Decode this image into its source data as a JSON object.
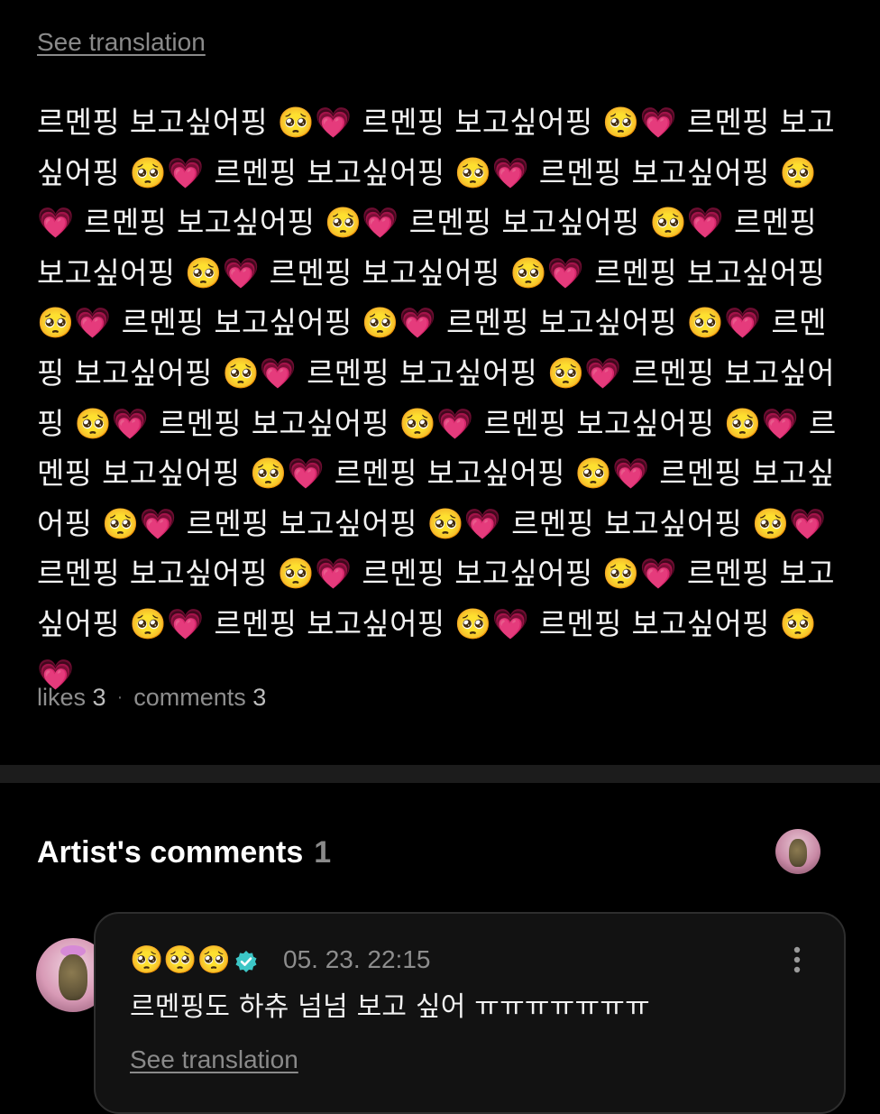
{
  "post": {
    "see_translation_label": "See translation",
    "body": "르멘핑 보고싶어핑 🥺💗 르멘핑 보고싶어핑 🥺💗 르멘핑 보고싶어핑 🥺💗 르멘핑 보고싶어핑 🥺💗 르멘핑 보고싶어핑 🥺💗 르멘핑 보고싶어핑 🥺💗 르멘핑 보고싶어핑 🥺💗 르멘핑 보고싶어핑 🥺💗 르멘핑 보고싶어핑 🥺💗 르멘핑 보고싶어핑 🥺💗 르멘핑 보고싶어핑 🥺💗 르멘핑 보고싶어핑 🥺💗 르멘핑 보고싶어핑 🥺💗 르멘핑 보고싶어핑 🥺💗 르멘핑 보고싶어핑 🥺💗 르멘핑 보고싶어핑 🥺💗 르멘핑 보고싶어핑 🥺💗 르멘핑 보고싶어핑 🥺💗 르멘핑 보고싶어핑 🥺💗 르멘핑 보고싶어핑 🥺💗 르멘핑 보고싶어핑 🥺💗 르멘핑 보고싶어핑 🥺💗 르멘핑 보고싶어핑 🥺💗 르멘핑 보고싶어핑 🥺💗 르멘핑 보고싶어핑 🥺💗 르멘핑 보고싶어핑 🥺💗 르멘핑 보고싶어핑 🥺💗",
    "likes_label": "likes",
    "likes_count": "3",
    "comments_label": "comments",
    "comments_count": "3",
    "separator": "·"
  },
  "artist_comments": {
    "title": "Artist's comments",
    "count": "1",
    "header_avatar_icon": "artist-avatar",
    "comments": [
      {
        "author": "🥺🥺🥺",
        "verified_icon": "verified-badge-icon",
        "verified_color": "#3cc6c6",
        "date": "05. 23. 22:15",
        "text": "르멘핑도 하츄 넘넘 보고 싶어 ㅠㅠㅠㅠㅠㅠㅠ",
        "see_translation_label": "See translation",
        "more_icon": "more-vertical-icon"
      }
    ]
  },
  "colors": {
    "background": "#000000",
    "divider": "#1c1c1c",
    "card": "#121212",
    "muted_text": "#8d8d8d"
  }
}
